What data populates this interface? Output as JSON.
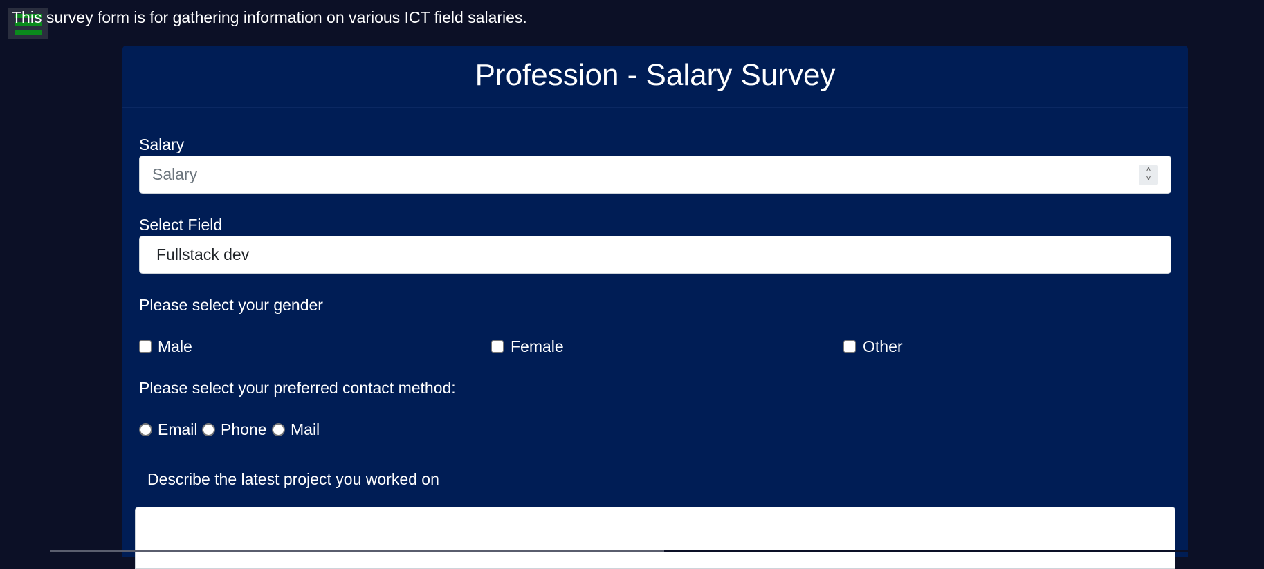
{
  "intro_text": "This survey form is for gathering information on various ICT field salaries.",
  "menu": {
    "icon": "hamburger-menu-icon"
  },
  "form": {
    "title": "Profession - Salary Survey",
    "salary": {
      "label": "Salary",
      "placeholder": "Salary"
    },
    "field": {
      "label": "Select Field",
      "selected": "Fullstack dev"
    },
    "gender": {
      "prompt": "Please select your gender",
      "options": [
        "Male",
        "Female",
        "Other"
      ]
    },
    "contact": {
      "prompt": "Please select your preferred contact method:",
      "options": [
        "Email",
        "Phone",
        "Mail"
      ]
    },
    "project": {
      "label": "Describe the latest project you worked on",
      "value": ""
    }
  },
  "colors": {
    "page_bg": "#0c1026",
    "card_bg": "#001d55",
    "menu_bar": "#0a8a1c"
  }
}
